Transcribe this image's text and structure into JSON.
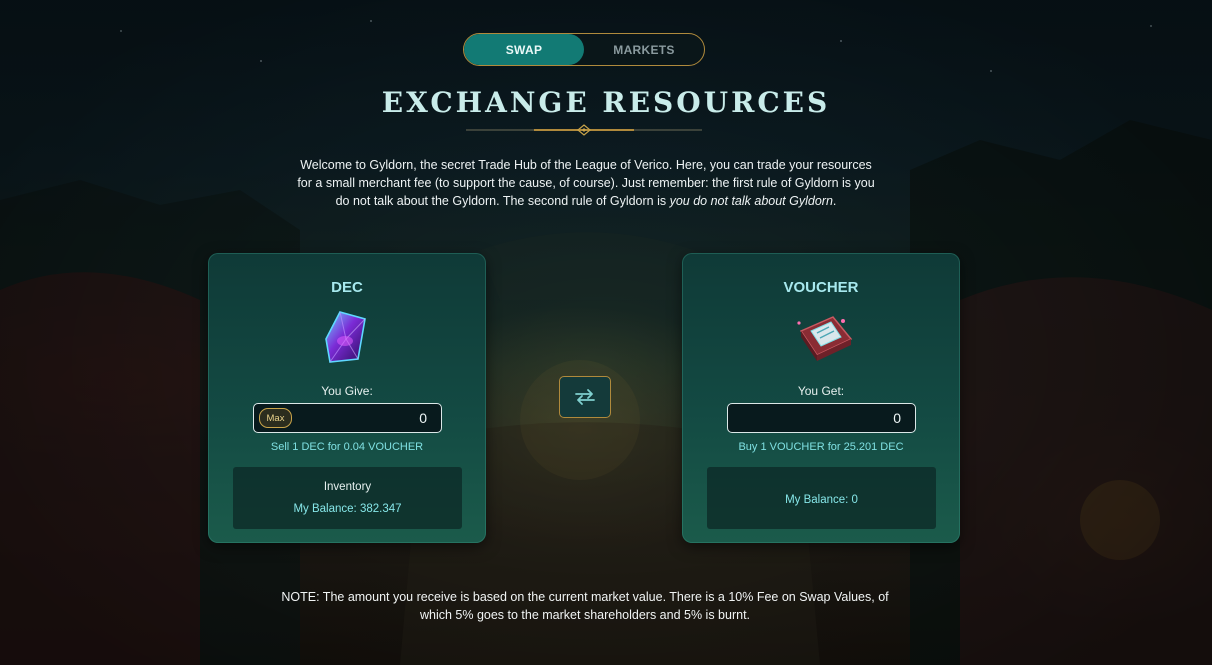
{
  "tabs": [
    {
      "label": "SWAP",
      "active": true
    },
    {
      "label": "MARKETS",
      "active": false
    }
  ],
  "title": "EXCHANGE RESOURCES",
  "intro": {
    "text": "Welcome to Gyldorn, the secret Trade Hub of the League of Verico. Here, you can trade your resources for a small merchant fee (to support the cause, of course). Just remember: the first rule of Gyldorn is you do not talk about the Gyldorn. The second rule of Gyldorn is ",
    "emphasis": "you do not talk about Gyldorn",
    "end": "."
  },
  "give_card": {
    "title": "DEC",
    "icon": "dec-crystal-icon",
    "label": "You Give:",
    "max_label": "Max",
    "amount": "0",
    "rate": "Sell 1 DEC for 0.04 VOUCHER",
    "inventory_label": "Inventory",
    "balance": "My Balance: 382.347"
  },
  "get_card": {
    "title": "VOUCHER",
    "icon": "voucher-book-icon",
    "label": "You Get:",
    "amount": "0",
    "rate": "Buy 1 VOUCHER for 25.201 DEC",
    "balance": "My Balance: 0"
  },
  "swap_icon": "swap-arrows-icon",
  "note": "NOTE: The amount you receive is based on the current market value. There is a 10% Fee on Swap Values, of which 5% goes to the market shareholders and 5% is burnt.",
  "colors": {
    "accent": "#127a74",
    "gold": "#b08a3c",
    "card": "#134a43",
    "cyan_text": "#7fe0e2"
  }
}
